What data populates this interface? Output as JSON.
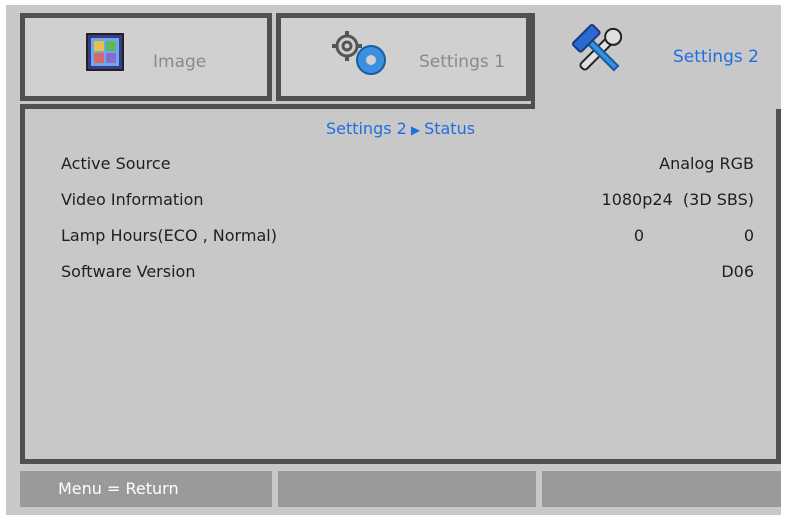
{
  "tabs": [
    {
      "label": "Image",
      "icon": "image-icon"
    },
    {
      "label": "Settings 1",
      "icon": "gears-icon"
    },
    {
      "label": "Settings 2",
      "icon": "tools-icon"
    }
  ],
  "breadcrumb": {
    "part1": "Settings 2",
    "part2": "Status"
  },
  "rows": [
    {
      "name": "Active Source",
      "value": "Analog RGB"
    },
    {
      "name": "Video Information",
      "value": "1080p24  (3D SBS)"
    },
    {
      "name": "Lamp Hours(ECO , Normal)",
      "value_eco": "0",
      "value_normal": "0"
    },
    {
      "name": "Software Version",
      "value": "D06"
    }
  ],
  "bottom": {
    "hint": "Menu = Return"
  },
  "colors": {
    "accent": "#1f6fe0",
    "frame": "#505050",
    "background": "#c8c8c8"
  }
}
